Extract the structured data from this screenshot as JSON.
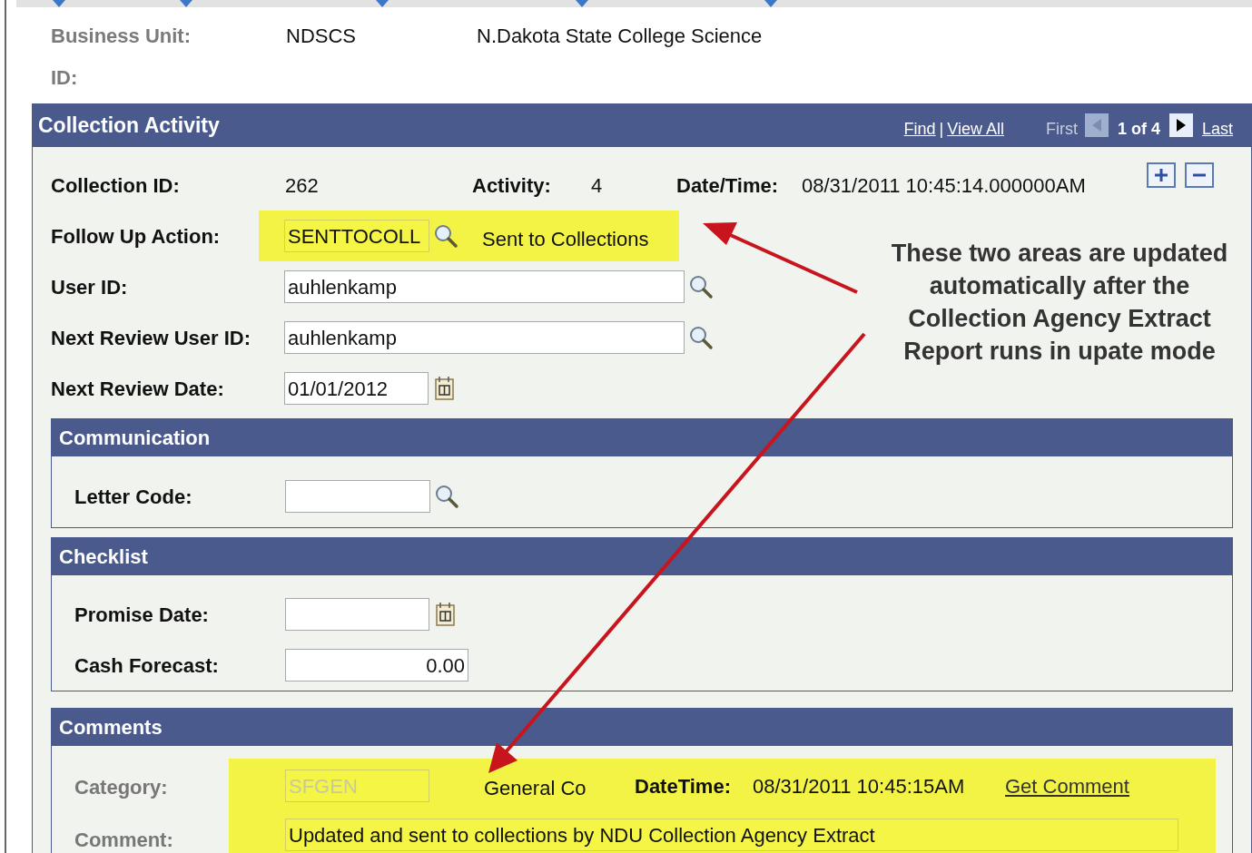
{
  "header": [
    {
      "label": "Business Unit:",
      "value": "NDSCS",
      "description": "N.Dakota State College Science"
    },
    {
      "label": "ID:"
    }
  ],
  "panel": {
    "title": "Collection Activity",
    "find": "Find",
    "separator": "|",
    "view_all": "View All",
    "first": "First",
    "previous_disabled": true,
    "position": "1 of 4",
    "next_disabled": false,
    "last": "Last",
    "summary": [
      {
        "label": "Collection ID:",
        "value": "262"
      },
      {
        "label": "Activity:",
        "value": "4"
      },
      {
        "label": "Date/Time:",
        "value": "08/31/2011 10:45:14.000000AM"
      }
    ],
    "fields": [
      {
        "kind": "code_lookup",
        "label": "Follow Up Action:",
        "value": "SENTTOCOLL",
        "description": "Sent to Collections",
        "highlighted": true
      },
      {
        "kind": "lookup",
        "label": "User ID:",
        "value": "auhlenkamp",
        "highlighted": false
      },
      {
        "kind": "lookup",
        "label": "Next Review User ID:",
        "value": "auhlenkamp",
        "highlighted": false
      },
      {
        "kind": "date",
        "label": "Next Review Date:",
        "value": "01/01/2012",
        "highlighted": false
      }
    ],
    "sections": [
      {
        "title": "Communication",
        "fields": [
          {
            "kind": "code_lookup",
            "label": "Letter Code:"
          }
        ]
      },
      {
        "title": "Checklist",
        "fields": [
          {
            "kind": "date",
            "label": "Promise Date:"
          },
          {
            "kind": "amount",
            "label": "Cash Forecast:",
            "value": "0.00"
          }
        ]
      }
    ],
    "comments": {
      "title": "Comments",
      "highlighted": true,
      "category_label": "Category:",
      "category": "SFGEN",
      "category_disabled": true,
      "category_description": "General Co",
      "datetime_label": "DateTime:",
      "datetime": "08/31/2011 10:45:15AM",
      "link": "Get Comment",
      "comment_label": "Comment:",
      "comment": "Updated and sent to collections by NDU Collection Agency Extract"
    }
  },
  "annotation": {
    "text": "These two areas are updated automatically after the Collection Agency Extract Report runs in upate mode"
  }
}
